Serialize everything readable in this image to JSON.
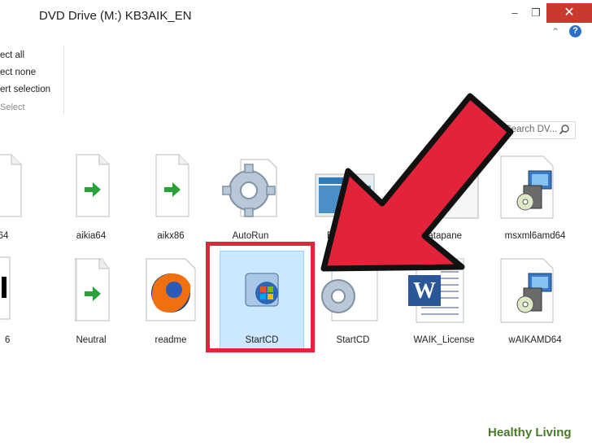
{
  "window": {
    "title": "DVD Drive (M:) KB3AIK_EN",
    "minimize_glyph": "–",
    "maximize_glyph": "❐",
    "close_glyph": "✕"
  },
  "ribbon": {
    "select_all": "ect all",
    "select_none": "ect none",
    "invert_selection": "ert selection",
    "group_label": "Select",
    "chevron_glyph": "⌃",
    "help_glyph": "?"
  },
  "search": {
    "placeholder": "Search DV..."
  },
  "files": [
    {
      "label": "64",
      "icon": "document-arrow-icon"
    },
    {
      "label": "aikia64",
      "icon": "document-arrow-icon"
    },
    {
      "label": "aikx86",
      "icon": "document-arrow-icon"
    },
    {
      "label": "AutoRun",
      "icon": "gear-settings-icon"
    },
    {
      "label": "Ba",
      "icon": "image-thumbnail-icon"
    },
    {
      "label": "datapane",
      "icon": "document-icon"
    },
    {
      "label": "msxml6amd64",
      "icon": "installer-package-icon"
    },
    {
      "label": "6",
      "icon": "document-icon"
    },
    {
      "label": "Neutral",
      "icon": "document-arrow-icon"
    },
    {
      "label": "readme",
      "icon": "firefox-icon"
    },
    {
      "label": "StartCD",
      "icon": "windows-app-icon"
    },
    {
      "label": "StartCD",
      "icon": "gear-settings-icon"
    },
    {
      "label": "WAIK_License",
      "icon": "word-document-icon"
    },
    {
      "label": "wAIKAMD64",
      "icon": "installer-package-icon"
    }
  ],
  "annotation": {
    "arrow_color": "#e2233a",
    "box_color": "#e2233a"
  },
  "watermark": {
    "text": "Healthy Living"
  }
}
